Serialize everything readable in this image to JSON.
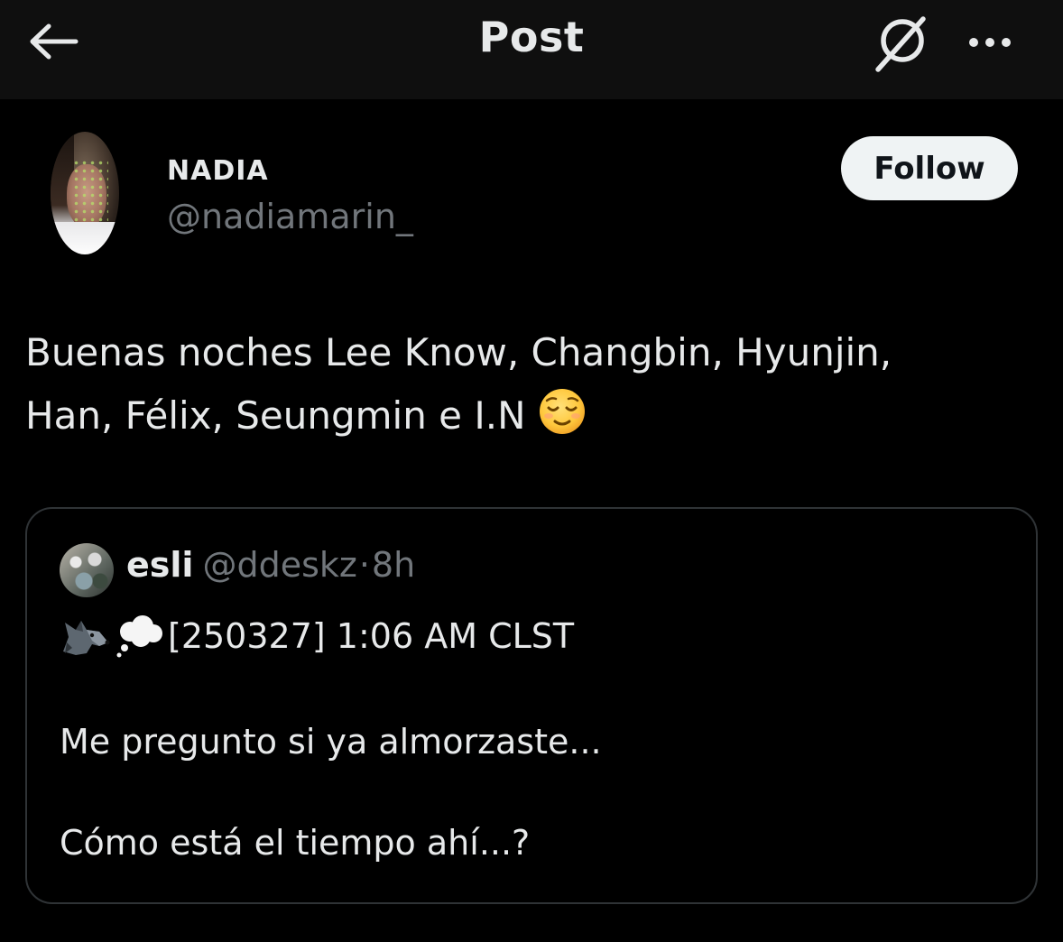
{
  "header": {
    "title": "Post",
    "back_icon": "arrow-left-icon",
    "grok_icon": "grok-icon",
    "more_icon": "more-dots-icon"
  },
  "author": {
    "display_name": "NADIA",
    "handle": "@nadiamarin_",
    "follow_label": "Follow"
  },
  "post": {
    "text": "Buenas noches Lee Know, Changbin, Hyunjin,\nHan, Félix, Seungmin e I.N"
  },
  "quoted_post": {
    "display_name": "esli",
    "handle": "@ddeskz",
    "separator": "·",
    "time": "8h",
    "first_line": "[250327] 1:06 AM CLST",
    "body": "Me pregunto si ya almorzaste...\n\nCómo está el tiempo ahí...?"
  },
  "colors": {
    "background": "#000000",
    "header_bg": "#0f0f0f",
    "text_primary": "#e7e9ea",
    "text_secondary": "#71767b",
    "border": "#2f3336",
    "button_bg": "#eff3f4"
  }
}
